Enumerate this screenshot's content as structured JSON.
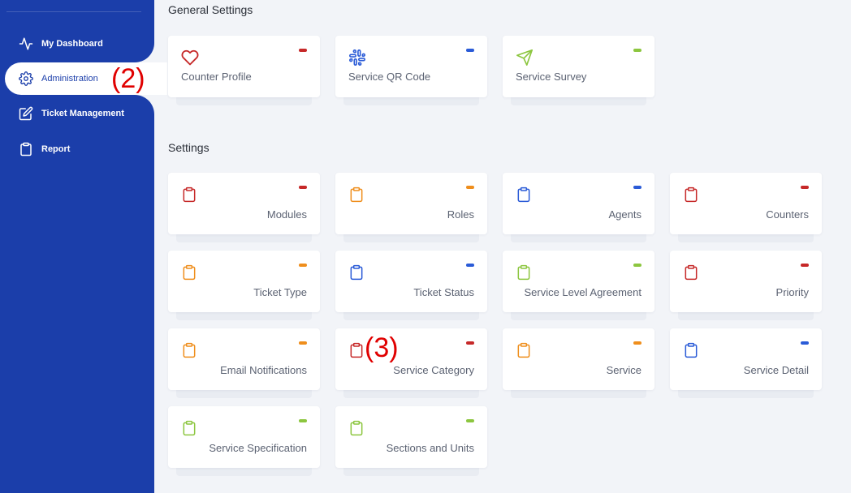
{
  "sidebar": {
    "items": [
      {
        "label": "My Dashboard",
        "icon": "activity-icon"
      },
      {
        "label": "Administration",
        "icon": "gear-icon"
      },
      {
        "label": "Ticket Management",
        "icon": "edit-icon"
      },
      {
        "label": "Report",
        "icon": "clipboard-icon"
      }
    ]
  },
  "annotations": {
    "admin_marker": "(2)",
    "service_category_marker": "(3)"
  },
  "colors": {
    "red": "#c62828",
    "orange": "#ef8e1c",
    "blue": "#2a5bd7",
    "green": "#8cc63f",
    "sidebar": "#1b3eaa"
  },
  "general": {
    "title": "General Settings",
    "cards": [
      {
        "label": "Counter Profile",
        "icon": "heart-icon",
        "color": "red"
      },
      {
        "label": "Service QR Code",
        "icon": "slack-icon",
        "color": "blue"
      },
      {
        "label": "Service Survey",
        "icon": "send-icon",
        "color": "green"
      }
    ]
  },
  "settings": {
    "title": "Settings",
    "cards": [
      {
        "label": "Modules",
        "color": "red"
      },
      {
        "label": "Roles",
        "color": "orange"
      },
      {
        "label": "Agents",
        "color": "blue"
      },
      {
        "label": "Counters",
        "color": "red"
      },
      {
        "label": "Ticket Type",
        "color": "orange"
      },
      {
        "label": "Ticket Status",
        "color": "blue"
      },
      {
        "label": "Service Level Agreement",
        "color": "green"
      },
      {
        "label": "Priority",
        "color": "red"
      },
      {
        "label": "Email Notifications",
        "color": "orange"
      },
      {
        "label": "Service Category",
        "color": "red"
      },
      {
        "label": "Service",
        "color": "orange"
      },
      {
        "label": "Service Detail",
        "color": "blue"
      },
      {
        "label": "Service Specification",
        "color": "green"
      },
      {
        "label": "Sections and Units",
        "color": "green"
      }
    ]
  }
}
